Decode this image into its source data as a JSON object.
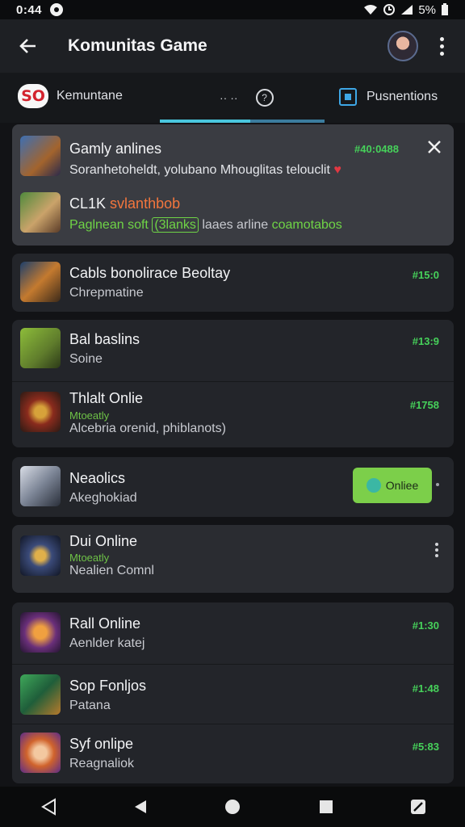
{
  "status_bar": {
    "time": "0:44",
    "battery": "5%"
  },
  "app_bar": {
    "title": "Komunitas Game"
  },
  "tabs": {
    "left_label": "Kemuntane",
    "mid_text": "·· ··",
    "right_label": "Pusnentions"
  },
  "notice": {
    "title": "Gamly anlines",
    "price": "#40:0488",
    "desc": "Soranhetoheldt, yolubano Mhouglitas telouclit",
    "item2_prefix": "CL1K",
    "item2_accent": "svlanthbob",
    "line_green": "Paglnean soft",
    "line_tag": "(3lanks",
    "line_rest": "laaes arline",
    "line_green2": "coamotabos"
  },
  "games": [
    {
      "name": "Cabls bonolirace Beoltay",
      "sub": "Chrepmatine",
      "price": "#15:0"
    },
    {
      "name": "Bal baslins",
      "sub": "Soine",
      "price": "#13:9"
    },
    {
      "name": "Thlalt Onlie",
      "status": "Mtoeatly",
      "sub": "Alcebria orenid, phiblanots)",
      "price": "#1758"
    },
    {
      "name": "Neaolics",
      "sub": "Akeghokiad",
      "button": "Onliee"
    },
    {
      "name": "Dui Online",
      "status": "Mtoeatly",
      "sub": "Nealien Comnl"
    },
    {
      "name": "Rall Online",
      "sub": "Aenlder katej",
      "price": "#1:30"
    },
    {
      "name": "Sop Fonljos",
      "sub": "Patana",
      "price": "#1:48"
    },
    {
      "name": "Syf onlipe",
      "sub": "Reagnaliok",
      "price": "#5:83"
    }
  ],
  "colors": {
    "accent_price": "#46d15a",
    "tab_indicator": "#49c6de",
    "online_button": "#7ccf4a"
  }
}
